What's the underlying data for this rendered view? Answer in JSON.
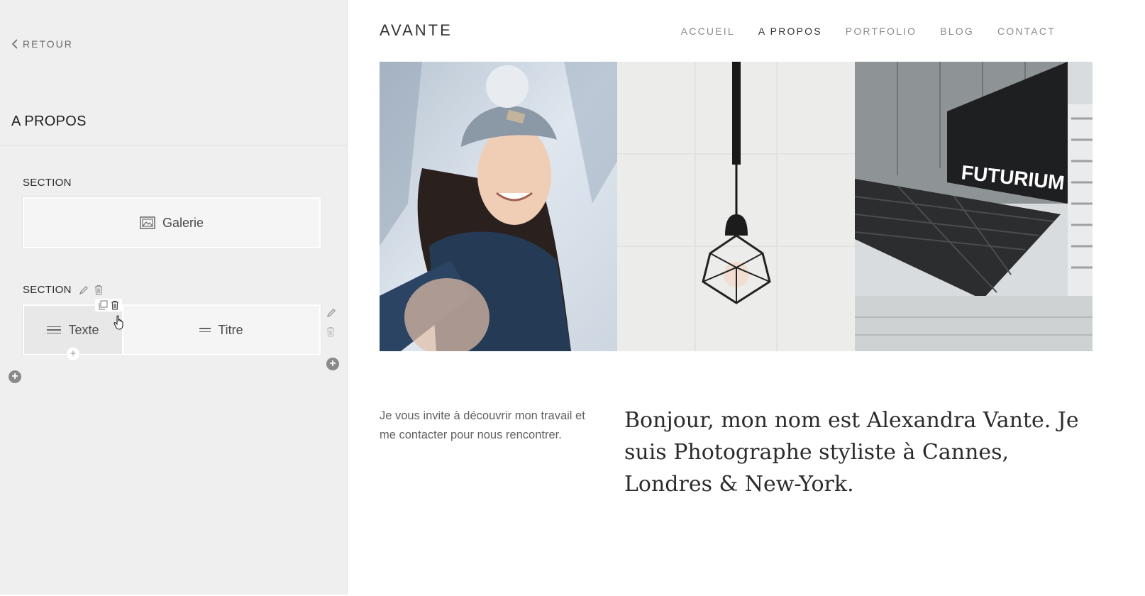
{
  "sidebar": {
    "back_label": "RETOUR",
    "page_title": "A PROPOS",
    "sections": [
      {
        "label": "SECTION",
        "blocks": [
          {
            "label": "Galerie"
          }
        ]
      },
      {
        "label": "SECTION",
        "blocks": [
          {
            "label": "Texte"
          },
          {
            "label": "Titre"
          }
        ]
      }
    ]
  },
  "site": {
    "logo": "AVANTE",
    "nav": [
      {
        "label": "ACCUEIL"
      },
      {
        "label": "A PROPOS",
        "active": true
      },
      {
        "label": "PORTFOLIO"
      },
      {
        "label": "BLOG"
      },
      {
        "label": "CONTACT"
      }
    ],
    "gallery": [
      {
        "alt": "woman in knit hat in snow"
      },
      {
        "alt": "hanging geometric light bulb"
      },
      {
        "alt": "Futurium building facade",
        "sign": "FUTURIUM"
      }
    ],
    "intro_text": "Je vous invite à découvrir mon travail et me contacter pour nous rencontrer.",
    "headline": "Bonjour, mon nom est Alexandra Vante. Je suis Photographe styliste à Cannes, Londres & New-York."
  },
  "colors": {
    "sidebar_bg": "#efefef",
    "nav_active": "#333333",
    "nav_inactive": "#8b8b8b"
  }
}
